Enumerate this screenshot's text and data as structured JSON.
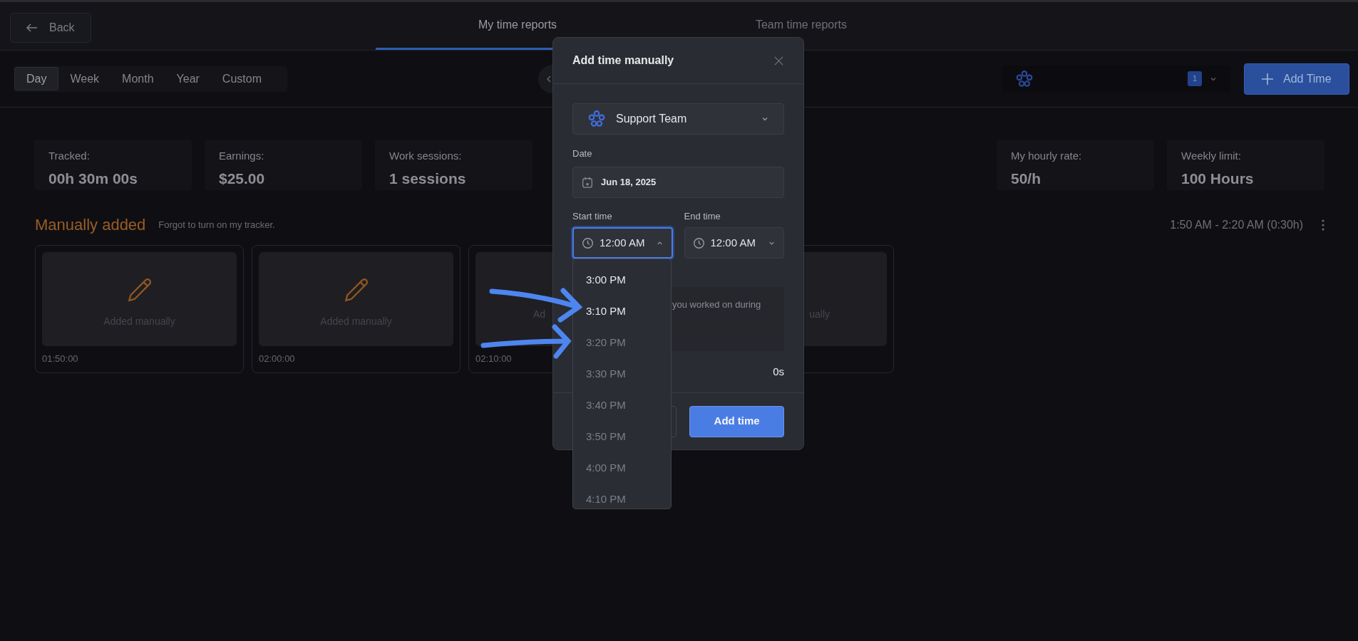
{
  "header": {
    "back": "Back",
    "tabs": [
      {
        "label": "My time reports",
        "selected": true
      },
      {
        "label": "Team time reports",
        "selected": false
      }
    ]
  },
  "periods": [
    {
      "label": "Day",
      "selected": true
    },
    {
      "label": "Week",
      "selected": false
    },
    {
      "label": "Month",
      "selected": false
    },
    {
      "label": "Year",
      "selected": false
    },
    {
      "label": "Custom",
      "selected": false
    }
  ],
  "team_filter": {
    "badge": "1"
  },
  "add_time_button": "Add Time",
  "stats_left": [
    {
      "label": "Tracked:",
      "value": "00h 30m 00s"
    },
    {
      "label": "Earnings:",
      "value": "$25.00"
    },
    {
      "label": "Work sessions:",
      "value": "1 sessions"
    }
  ],
  "stats_right": [
    {
      "label": "My hourly rate:",
      "value": "50/h"
    },
    {
      "label": "Weekly limit:",
      "value": "100 Hours"
    }
  ],
  "session": {
    "title": "Manually added",
    "note": "Forgot to turn on my tracker.",
    "range": "1:50 AM - 2:20 AM (0:30h)"
  },
  "cards": [
    {
      "kind": "full",
      "label": "Added manually",
      "time": "01:50:00"
    },
    {
      "kind": "full",
      "label": "Added manually",
      "time": "02:00:00"
    },
    {
      "kind": "right-covered",
      "label": "Ad",
      "time": "02:10:00"
    },
    {
      "kind": "left-covered",
      "label": "ually"
    }
  ],
  "dialog": {
    "title": "Add time manually",
    "team": "Support Team",
    "date_label": "Date",
    "date": "Jun 18, 2025",
    "start_label": "Start time",
    "start": "12:00 AM",
    "start_open": true,
    "end_label": "End time",
    "end": "12:00 AM",
    "description_placeholder": "you worked on during",
    "duration": "0s",
    "submit": "Add time"
  },
  "time_options": [
    {
      "label": "3:00 PM",
      "disabled": false
    },
    {
      "label": "3:10 PM",
      "disabled": false
    },
    {
      "label": "3:20 PM",
      "disabled": true
    },
    {
      "label": "3:30 PM",
      "disabled": true
    },
    {
      "label": "3:40 PM",
      "disabled": true
    },
    {
      "label": "3:50 PM",
      "disabled": true
    },
    {
      "label": "4:00 PM",
      "disabled": true
    },
    {
      "label": "4:10 PM",
      "disabled": true
    }
  ]
}
